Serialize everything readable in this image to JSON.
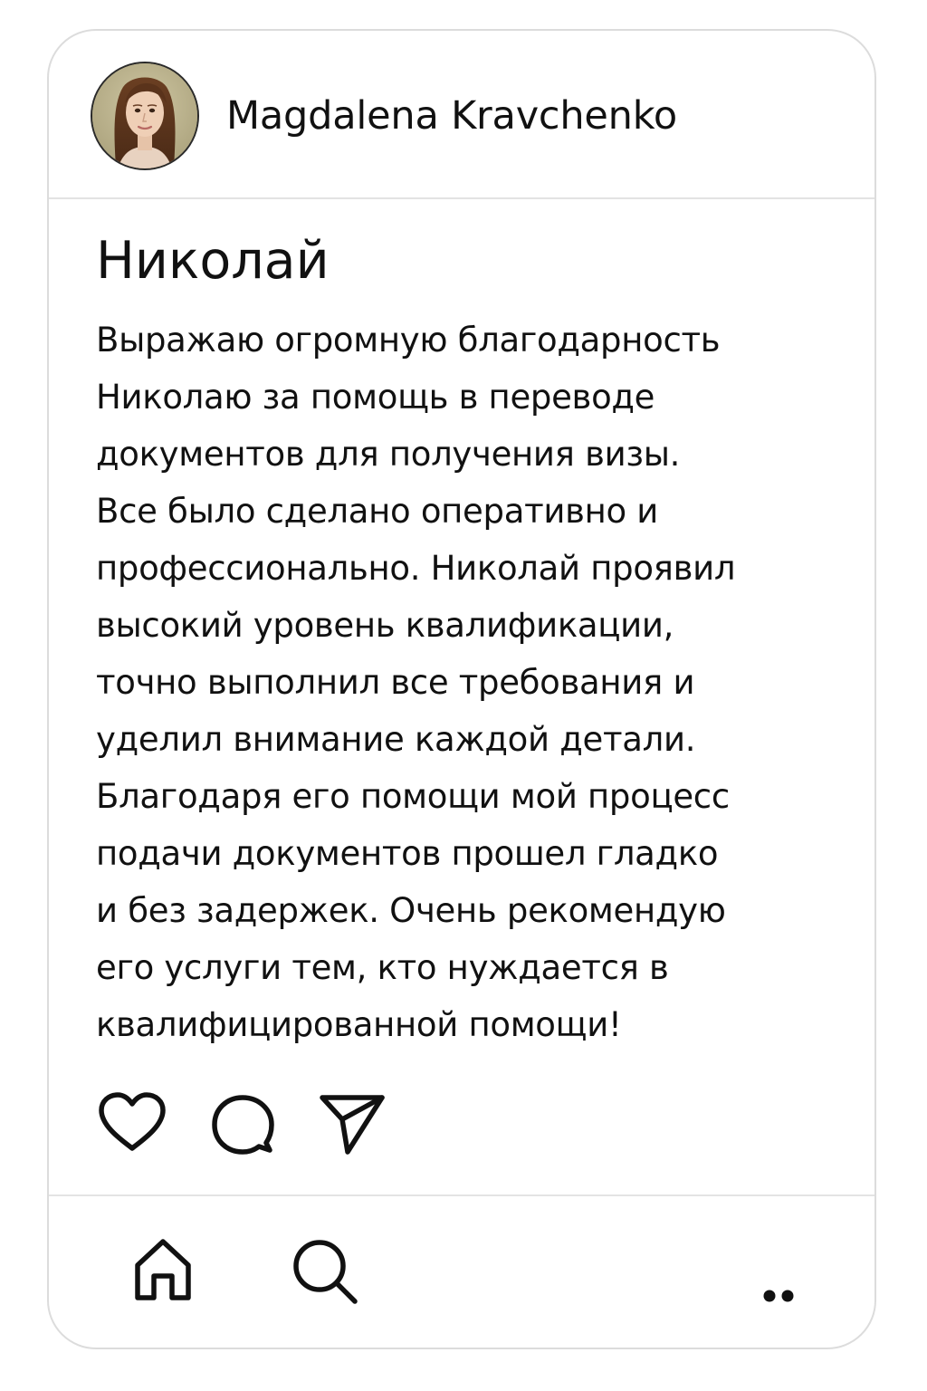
{
  "post": {
    "author": {
      "name": "Magdalena Kravchenko"
    },
    "title": "Николай",
    "body_lines": [
      "Выражаю огромную благодарность",
      "Николаю за помощь в переводе",
      "документов для получения визы.",
      "Все было сделано оперативно и",
      "профессионально. Николай проявил",
      "высокий уровень квалификации,",
      "точно выполнил все требования и",
      "уделил внимание каждой детали.",
      "Благодаря его помощи мой процесс",
      "подачи документов прошел гладко",
      "и без задержек. Очень рекомендую",
      "его услуги тем, кто нуждается в",
      "квалифицированной помощи!"
    ],
    "actions": {
      "icons": [
        "heart-icon",
        "comment-icon",
        "share-icon"
      ]
    }
  },
  "bottom_nav": {
    "icons": [
      "home-icon",
      "search-icon",
      "more-icon"
    ]
  },
  "colors": {
    "text": "#111111",
    "divider": "#e3e3e3",
    "card_border": "#dcdcdc",
    "background": "#ffffff"
  }
}
